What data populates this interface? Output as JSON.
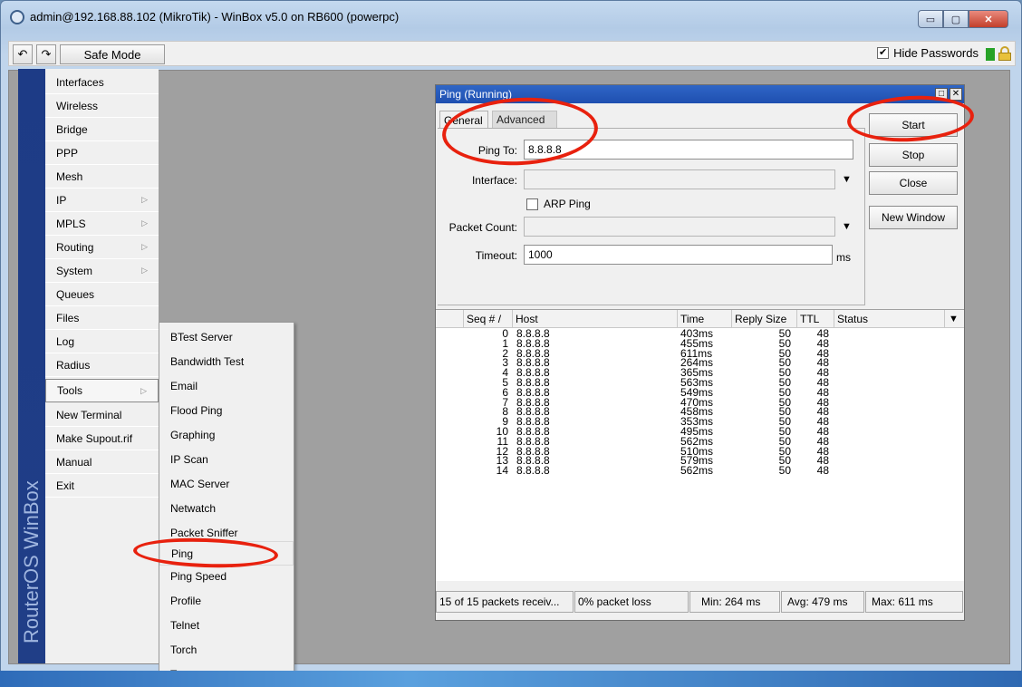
{
  "window": {
    "title": "admin@192.168.88.102 (MikroTik) - WinBox v5.0 on RB600 (powerpc)",
    "controls": {
      "minimize": "▭",
      "maximize": "▢",
      "close": "✕"
    }
  },
  "toolbar": {
    "undo": "↶",
    "redo": "↷",
    "safe_mode": "Safe Mode",
    "hide_passwords": "Hide Passwords",
    "hide_passwords_checked": "✔"
  },
  "brand": "RouterOS WinBox",
  "menu": [
    {
      "label": "Interfaces",
      "arrow": ""
    },
    {
      "label": "Wireless",
      "arrow": ""
    },
    {
      "label": "Bridge",
      "arrow": ""
    },
    {
      "label": "PPP",
      "arrow": ""
    },
    {
      "label": "Mesh",
      "arrow": ""
    },
    {
      "label": "IP",
      "arrow": "▷"
    },
    {
      "label": "MPLS",
      "arrow": "▷"
    },
    {
      "label": "Routing",
      "arrow": "▷"
    },
    {
      "label": "System",
      "arrow": "▷"
    },
    {
      "label": "Queues",
      "arrow": ""
    },
    {
      "label": "Files",
      "arrow": ""
    },
    {
      "label": "Log",
      "arrow": ""
    },
    {
      "label": "Radius",
      "arrow": ""
    },
    {
      "label": "Tools",
      "arrow": "▷"
    },
    {
      "label": "New Terminal",
      "arrow": ""
    },
    {
      "label": "Make Supout.rif",
      "arrow": ""
    },
    {
      "label": "Manual",
      "arrow": ""
    },
    {
      "label": "Exit",
      "arrow": ""
    }
  ],
  "tools_submenu": [
    "BTest Server",
    "Bandwidth Test",
    "Email",
    "Flood Ping",
    "Graphing",
    "IP Scan",
    "MAC Server",
    "Netwatch",
    "Packet Sniffer",
    "Ping",
    "Ping Speed",
    "Profile",
    "Telnet",
    "Torch",
    "Traceroute"
  ],
  "ping": {
    "title": "Ping (Running)",
    "tabs": {
      "general": "General",
      "advanced": "Advanced"
    },
    "fields": {
      "ping_to_label": "Ping To:",
      "ping_to_value": "8.8.8.8",
      "interface_label": "Interface:",
      "interface_value": "",
      "arp_ping_label": "ARP Ping",
      "packet_count_label": "Packet Count:",
      "packet_count_value": "",
      "timeout_label": "Timeout:",
      "timeout_value": "1000",
      "timeout_unit": "ms",
      "dropdown_arrow": "▼"
    },
    "buttons": {
      "start": "Start",
      "stop": "Stop",
      "close": "Close",
      "new_window": "New Window"
    },
    "columns": [
      "Seq # /",
      "Host",
      "Time",
      "Reply Size",
      "TTL",
      "Status"
    ],
    "column_menu": "▼",
    "rows": [
      {
        "seq": "0",
        "host": "8.8.8.8",
        "time": "403ms",
        "size": "50",
        "ttl": "48",
        "status": ""
      },
      {
        "seq": "1",
        "host": "8.8.8.8",
        "time": "455ms",
        "size": "50",
        "ttl": "48",
        "status": ""
      },
      {
        "seq": "2",
        "host": "8.8.8.8",
        "time": "611ms",
        "size": "50",
        "ttl": "48",
        "status": ""
      },
      {
        "seq": "3",
        "host": "8.8.8.8",
        "time": "264ms",
        "size": "50",
        "ttl": "48",
        "status": ""
      },
      {
        "seq": "4",
        "host": "8.8.8.8",
        "time": "365ms",
        "size": "50",
        "ttl": "48",
        "status": ""
      },
      {
        "seq": "5",
        "host": "8.8.8.8",
        "time": "563ms",
        "size": "50",
        "ttl": "48",
        "status": ""
      },
      {
        "seq": "6",
        "host": "8.8.8.8",
        "time": "549ms",
        "size": "50",
        "ttl": "48",
        "status": ""
      },
      {
        "seq": "7",
        "host": "8.8.8.8",
        "time": "470ms",
        "size": "50",
        "ttl": "48",
        "status": ""
      },
      {
        "seq": "8",
        "host": "8.8.8.8",
        "time": "458ms",
        "size": "50",
        "ttl": "48",
        "status": ""
      },
      {
        "seq": "9",
        "host": "8.8.8.8",
        "time": "353ms",
        "size": "50",
        "ttl": "48",
        "status": ""
      },
      {
        "seq": "10",
        "host": "8.8.8.8",
        "time": "495ms",
        "size": "50",
        "ttl": "48",
        "status": ""
      },
      {
        "seq": "11",
        "host": "8.8.8.8",
        "time": "562ms",
        "size": "50",
        "ttl": "48",
        "status": ""
      },
      {
        "seq": "12",
        "host": "8.8.8.8",
        "time": "510ms",
        "size": "50",
        "ttl": "48",
        "status": ""
      },
      {
        "seq": "13",
        "host": "8.8.8.8",
        "time": "579ms",
        "size": "50",
        "ttl": "48",
        "status": ""
      },
      {
        "seq": "14",
        "host": "8.8.8.8",
        "time": "562ms",
        "size": "50",
        "ttl": "48",
        "status": ""
      }
    ],
    "status": {
      "received": "15 of 15 packets receiv...",
      "loss": "0% packet loss",
      "min": "Min: 264 ms",
      "avg": "Avg: 479 ms",
      "max": "Max: 611 ms"
    }
  },
  "colors": {
    "annotation": "#e8210e",
    "title_bar": "#2f66c6",
    "brand_strip": "#1d3b86"
  }
}
